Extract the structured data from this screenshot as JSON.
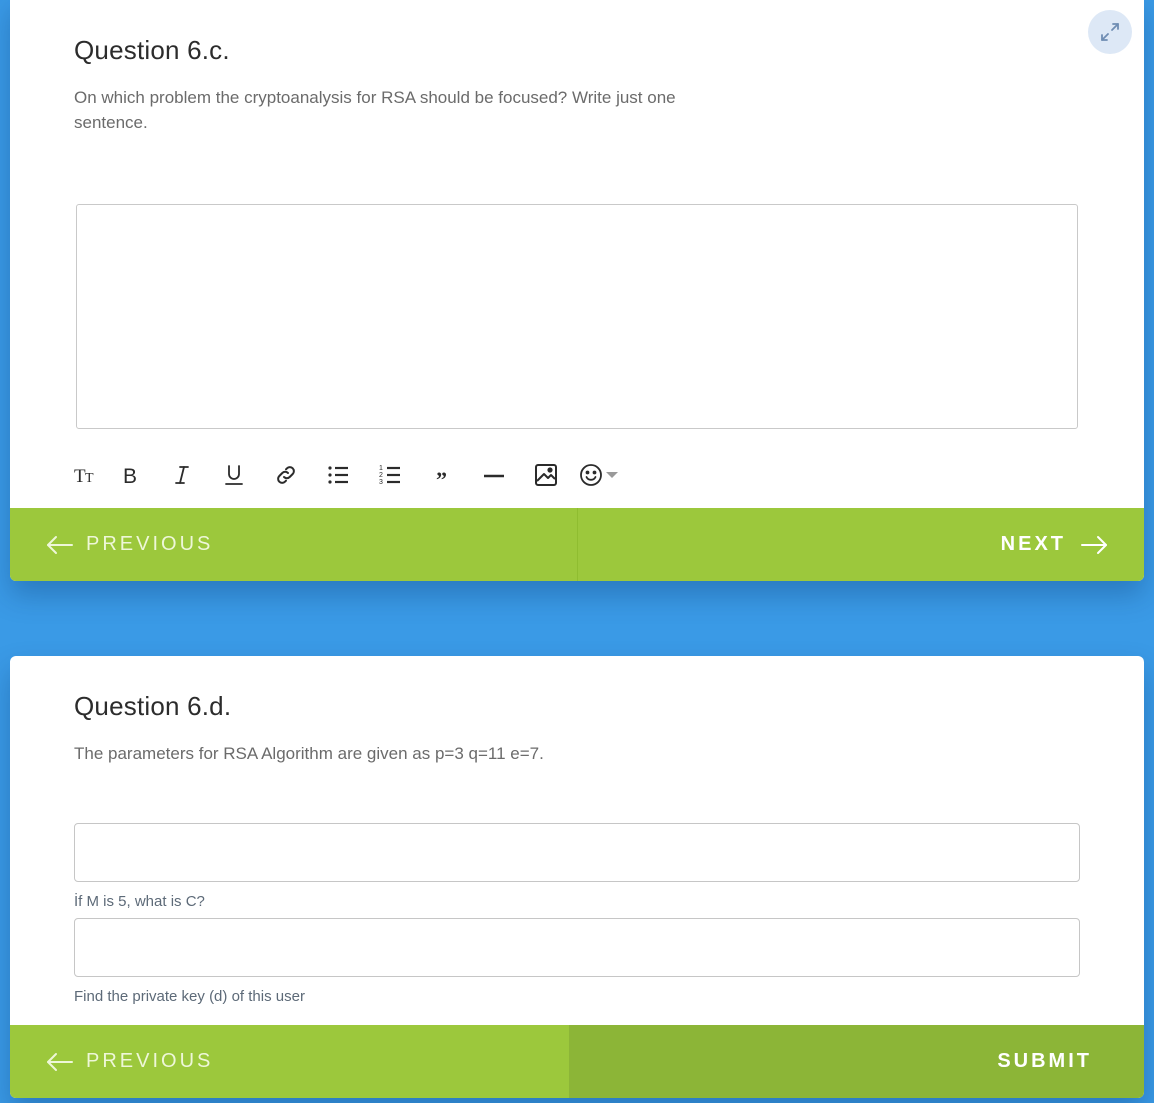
{
  "question_c": {
    "title": "Question 6.c.",
    "text": "On which problem the cryptoanalysis for RSA should be focused? Write just one sentence.",
    "answer": "",
    "toolbar": [
      {
        "icon": "text-size-icon"
      },
      {
        "icon": "bold-icon"
      },
      {
        "icon": "italic-icon"
      },
      {
        "icon": "underline-icon"
      },
      {
        "icon": "link-icon"
      },
      {
        "icon": "bullet-list-icon"
      },
      {
        "icon": "numbered-list-icon"
      },
      {
        "icon": "quote-icon"
      },
      {
        "icon": "horizontal-rule-icon"
      },
      {
        "icon": "image-icon"
      },
      {
        "icon": "emoji-icon"
      }
    ],
    "prev_label": "PREVIOUS",
    "next_label": "NEXT"
  },
  "question_d": {
    "title": "Question 6.d.",
    "text": "The parameters for RSA Algorithm are given as p=3 q=11 e=7.",
    "fields": [
      {
        "value": "",
        "caption": "İf M is 5, what is C?"
      },
      {
        "value": "",
        "caption": "Find the private key (d) of this user"
      }
    ],
    "prev_label": "PREVIOUS",
    "submit_label": "SUBMIT"
  },
  "colors": {
    "background": "#3a9ae6",
    "nav_green": "#9cc83c",
    "submit_green": "#8cb537",
    "expand_bg": "#dde8f6"
  }
}
